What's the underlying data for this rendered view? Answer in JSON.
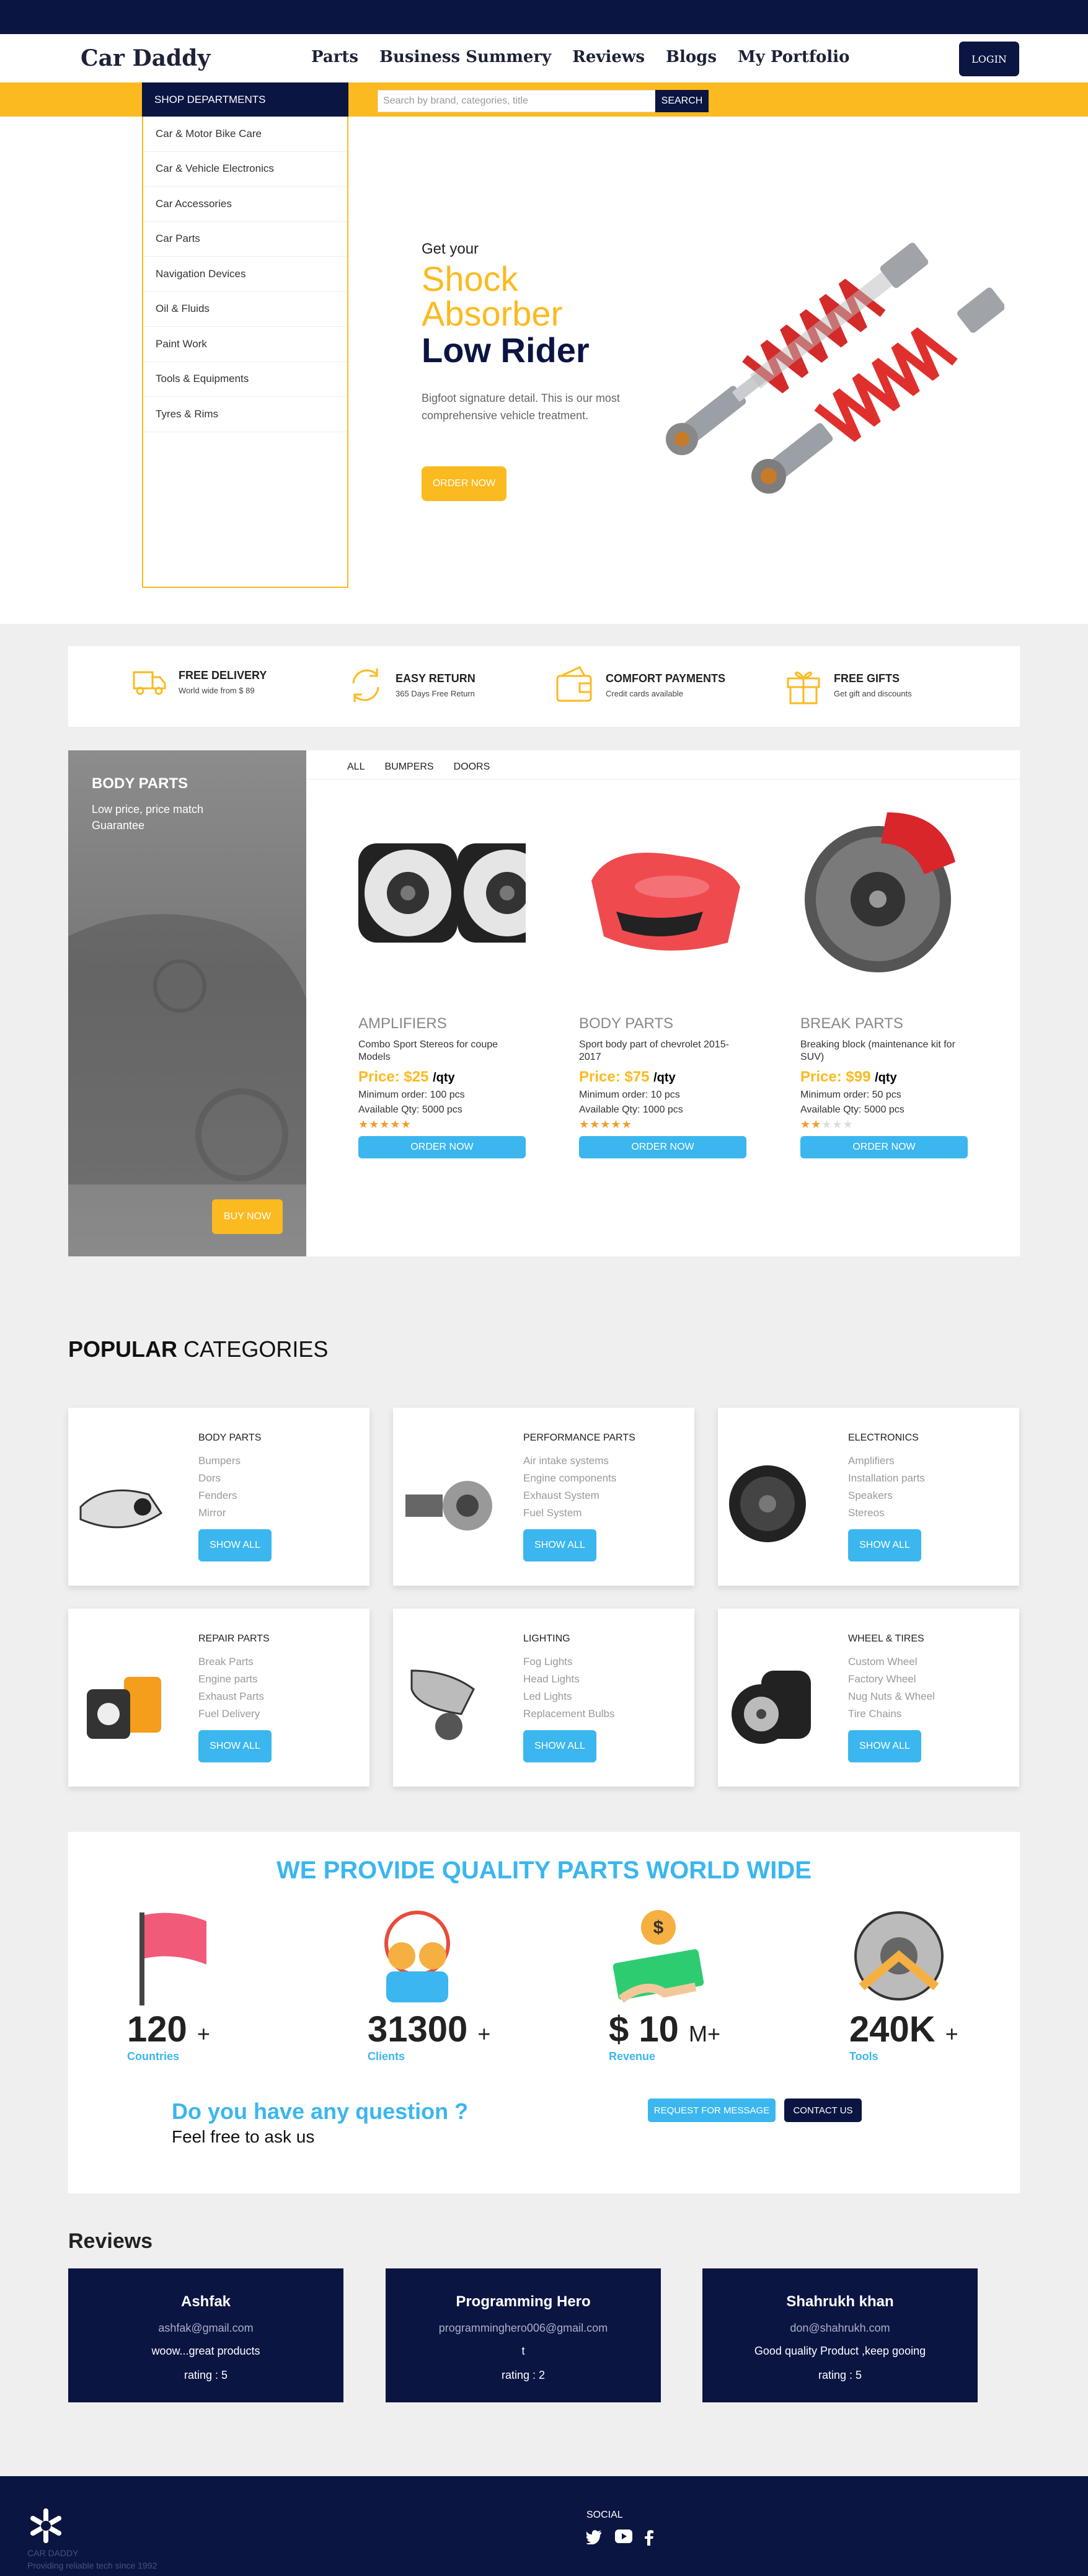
{
  "nav": {
    "brand": "Car Daddy",
    "links": [
      "Parts",
      "Business Summery",
      "Reviews",
      "Blogs",
      "My Portfolio"
    ],
    "login": "LOGIN"
  },
  "search": {
    "departments_label": "SHOP DEPARTMENTS",
    "placeholder": "Search by brand, categories, title",
    "button": "SEARCH"
  },
  "departments": [
    "Car & Motor Bike Care",
    "Car & Vehicle Electronics",
    "Car Accessories",
    "Car Parts",
    "Navigation Devices",
    "Oil & Fluids",
    "Paint Work",
    "Tools & Equipments",
    "Tyres & Rims"
  ],
  "hero": {
    "pre": "Get your",
    "line1": "Shock",
    "line2": "Absorber",
    "line3": "Low Rider",
    "desc": "Bigfoot signature detail. This is our most comprehensive vehicle treatment.",
    "button": "ORDER NOW"
  },
  "features": [
    {
      "title": "FREE DELIVERY",
      "sub": "World wide from $ 89",
      "icon": "truck-icon"
    },
    {
      "title": "EASY RETURN",
      "sub": "365 Days Free Return",
      "icon": "return-icon"
    },
    {
      "title": "COMFORT PAYMENTS",
      "sub": "Credit cards available",
      "icon": "wallet-icon"
    },
    {
      "title": "FREE GIFTS",
      "sub": "Get gift and discounts",
      "icon": "gift-icon"
    }
  ],
  "bodyparts": {
    "title": "BODY PARTS",
    "sub": "Low price, price match Guarantee",
    "buy": "BUY NOW",
    "tabs": [
      "ALL",
      "BUMPERS",
      "DOORS"
    ]
  },
  "products": [
    {
      "name": "AMPLIFIERS",
      "desc": "Combo Sport Stereos for coupe Models",
      "price": "Price: $25",
      "unit": "/qty",
      "min": "Minimum order: 100 pcs",
      "avail": "Available Qty: 5000 pcs",
      "rating": 5,
      "button": "ORDER NOW"
    },
    {
      "name": "BODY PARTS",
      "desc": "Sport body part of chevrolet 2015-2017",
      "price": "Price: $75",
      "unit": "/qty",
      "min": "Minimum order: 10 pcs",
      "avail": "Available Qty: 1000 pcs",
      "rating": 5,
      "button": "ORDER NOW"
    },
    {
      "name": "BREAK PARTS",
      "desc": "Breaking block (maintenance kit for SUV)",
      "price": "Price: $99",
      "unit": "/qty",
      "min": "Minimum order: 50 pcs",
      "avail": "Available Qty: 5000 pcs",
      "rating": 2,
      "button": "ORDER NOW"
    }
  ],
  "popular": {
    "title_bold": "POPULAR",
    "title_rest": " CATEGORIES",
    "cards": [
      {
        "title": "BODY PARTS",
        "items": [
          "Bumpers",
          "Dors",
          "Fenders",
          "Mirror"
        ],
        "button": "SHOW ALL"
      },
      {
        "title": "PERFORMANCE PARTS",
        "items": [
          "Air intake systems",
          "Engine components",
          "Exhaust System",
          "Fuel System"
        ],
        "button": "SHOW ALL"
      },
      {
        "title": "ELECTRONICS",
        "items": [
          "Amplifiers",
          "Installation parts",
          "Speakers",
          "Stereos"
        ],
        "button": "SHOW ALL"
      },
      {
        "title": "REPAIR PARTS",
        "items": [
          "Break Parts",
          "Engine parts",
          "Exhaust Parts",
          "Fuel Delivery"
        ],
        "button": "SHOW ALL"
      },
      {
        "title": "LIGHTING",
        "items": [
          "Fog Lights",
          "Head Lights",
          "Led Lights",
          "Replacement Bulbs"
        ],
        "button": "SHOW ALL"
      },
      {
        "title": "WHEEL & TIRES",
        "items": [
          "Custom Wheel",
          "Factory Wheel",
          "Nug Nuts & Wheel",
          "Tire Chains"
        ],
        "button": "SHOW ALL"
      }
    ]
  },
  "quality": {
    "title": "WE PROVIDE QUALITY PARTS WORLD WIDE",
    "stats": [
      {
        "num": "120",
        "suffix": "+",
        "label": "Countries"
      },
      {
        "num": "31300",
        "suffix": "+",
        "label": "Clients"
      },
      {
        "num": "$ 10",
        "suffix": "M+",
        "label": "Revenue"
      },
      {
        "num": "240K",
        "suffix": "+",
        "label": "Tools"
      }
    ],
    "question": "Do you have any question ?",
    "question_sub": "Feel free to ask us",
    "request": "REQUEST FOR MESSAGE",
    "contact": "CONTACT US"
  },
  "reviews": {
    "heading": "Reviews",
    "items": [
      {
        "name": "Ashfak",
        "email": "ashfak@gmail.com",
        "text": "woow...great products",
        "rating": "rating : 5"
      },
      {
        "name": "Programming Hero",
        "email": "programminghero006@gmail.com",
        "text": "t",
        "rating": "rating : 2"
      },
      {
        "name": "Shahrukh khan",
        "email": "don@shahrukh.com",
        "text": "Good quality Product ,keep gooing",
        "rating": "rating : 5"
      }
    ]
  },
  "footer": {
    "social": "SOCIAL",
    "line1": "CAR DADDY",
    "line2": "Providing reliable tech since 1992"
  },
  "colors": {
    "navy": "#0b1542",
    "yellow": "#fbba1f",
    "blue": "#3bb6ee"
  }
}
